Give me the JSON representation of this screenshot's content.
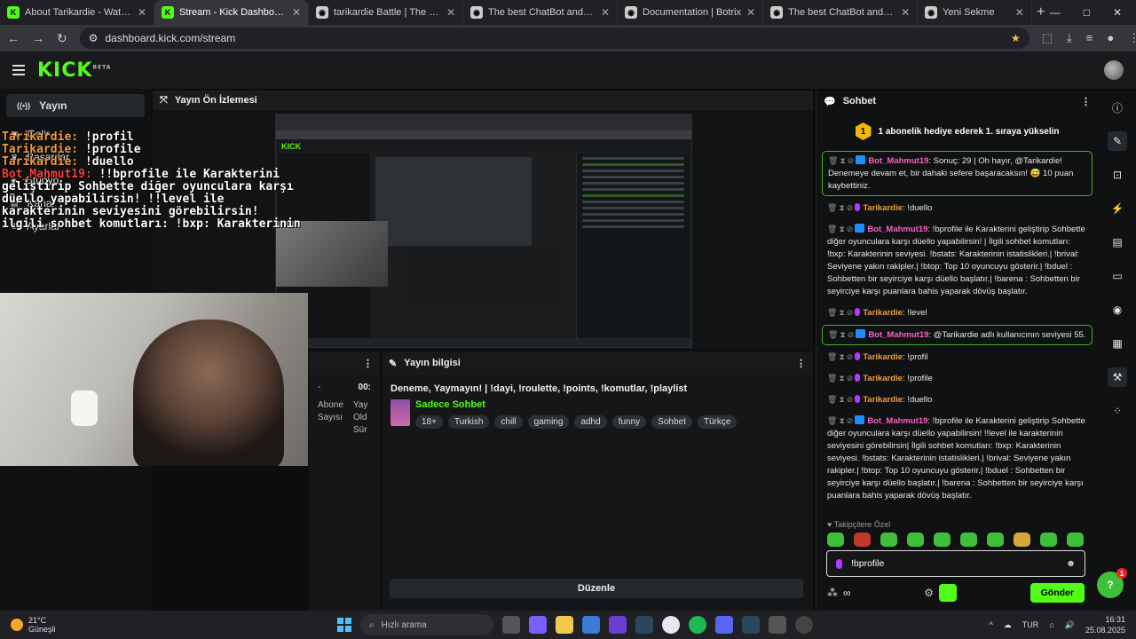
{
  "browser": {
    "tabs": [
      {
        "title": "About Tarikardie - Watch Live o",
        "color": "#53fc18",
        "fav": "K"
      },
      {
        "title": "Stream - Kick Dashboard",
        "color": "#53fc18",
        "fav": "K",
        "active": true
      },
      {
        "title": "tarikardie Battle | The best Chat",
        "color": "#cccccc",
        "fav": "◉"
      },
      {
        "title": "The best ChatBot and Widgets",
        "color": "#cccccc",
        "fav": "◉"
      },
      {
        "title": "Documentation | Botrix",
        "color": "#cccccc",
        "fav": "◉"
      },
      {
        "title": "The best ChatBot and Widgets",
        "color": "#cccccc",
        "fav": "◉"
      },
      {
        "title": "Yeni Sekme",
        "color": "#cccccc",
        "fav": "◉"
      }
    ],
    "url": "dashboard.kick.com/stream"
  },
  "app": {
    "logo": "KICK",
    "logo_tag": "BETA"
  },
  "leftnav": {
    "items": [
      {
        "label": "Yayın",
        "icon": "broadcast-icon"
      },
      {
        "label": "Gelir",
        "icon": "revenue-icon"
      },
      {
        "label": "Başarılar",
        "icon": "achievements-icon"
      },
      {
        "label": "Stüdyo",
        "icon": "studio-icon"
      },
      {
        "label": "Kanal",
        "icon": "channel-icon"
      },
      {
        "label": "Ayarlar",
        "icon": "settings-icon"
      }
    ]
  },
  "preview": {
    "title": "Yayın Ön İzlemesi",
    "mini_logo": "KICK"
  },
  "overlay_chat": [
    {
      "user": "Tarikardie:",
      "text": " !profil",
      "cls": "u1"
    },
    {
      "user": "Tarikardie:",
      "text": " !profile",
      "cls": "u1"
    },
    {
      "user": "Tarikardie:",
      "text": " !duello",
      "cls": "u1"
    },
    {
      "user": "Bot_Mahmut19:",
      "text": " !!bprofile ile Karakterini geliştirip Sohbette diğer oyunculara karşı düello yapabilirsin! !!level ile karakterinin seviyesini görebilirsin! ilgili sohbet komutları: !bxp: Karakterinin",
      "cls": "u2"
    }
  ],
  "stream_info": {
    "header": "Yayın bilgisi",
    "side_label_1": "-",
    "side_label_2": "Abone Sayısı",
    "side_time": "00:",
    "side_extra": "Yay Old Sür",
    "title": "Deneme, Yaymayın! | !dayi, !roulette, !points, !komutlar, !playlist",
    "category": "Sadece Sohbet",
    "tags": [
      "18+",
      "Turkish",
      "chill",
      "gaming",
      "adhd",
      "funny",
      "Sohbet",
      "Türkçe"
    ],
    "edit_button": "Düzenle"
  },
  "chat": {
    "header": "Sohbet",
    "goal_number": "1",
    "goal_text": "1 abonelik hediye ederek 1. sıraya yükselin",
    "messages": [
      {
        "user": "Bot_Mahmut19",
        "kind": "bot",
        "hl": true,
        "text": ": Sonuç: 29 | Oh hayır, @Tarikardie! Denemeye devam et, bir dahaki sefere başaracaksın! 😅 10 puan kaybettiniz."
      },
      {
        "user": "Tarikardie",
        "kind": "tar",
        "hl": false,
        "text": ": !duello"
      },
      {
        "user": "Bot_Mahmut19",
        "kind": "bot",
        "hl": false,
        "text": ": !bprofile ile Karakterini geliştirip Sohbette diğer oyunculara karşı düello yapabilirsin! | İlgili sohbet komutları: !bxp: Karakterinin seviyesi. !bstats: Karakterinin istatislikleri.| !brival: Seviyene yakın rakipler.| !btop: Top 10 oyuncuyu gösterir.| !bduel : Sohbetten bir seyirciye karşı düello başlatır.| !barena : Sohbetten bir seyirciye karşı puanlara bahis yaparak dövüş başlatır."
      },
      {
        "user": "Tarikardie",
        "kind": "tar",
        "hl": false,
        "text": ": !level"
      },
      {
        "user": "Bot_Mahmut19",
        "kind": "bot",
        "hl": true,
        "text": ": @Tarikardie adlı kullanıcının seviyesi 55."
      },
      {
        "user": "Tarikardie",
        "kind": "tar",
        "hl": false,
        "text": ": !profil"
      },
      {
        "user": "Tarikardie",
        "kind": "tar",
        "hl": false,
        "text": ": !profile"
      },
      {
        "user": "Tarikardie",
        "kind": "tar",
        "hl": false,
        "text": ": !duello"
      },
      {
        "user": "Bot_Mahmut19",
        "kind": "bot",
        "hl": false,
        "text": ": !bprofile ile Karakterini geliştirip Sohbette diğer oyunculara karşı düello yapabilirsin! !!level ile karakterinin seviyesini görebilirsin| İlgili sohbet komutları: !bxp: Karakterinin seviyesi. !bstats: Karakterinin istatislikleri.| !brival: Seviyene yakın rakipler.| !btop: Top 10 oyuncuyu gösterir.| !bduel : Sohbetten bir seyirciye karşı düello başlatır.| !barena : Sohbetten bir seyirciye karşı puanlara bahis yaparak dövüş başlatır."
      }
    ],
    "followers_label": "Takipçilere Özel",
    "input_value": "!bprofile",
    "send_label": "Gönder"
  },
  "help_badge": "1",
  "taskbar": {
    "temp": "21°C",
    "weather": "Güneşli",
    "search_placeholder": "Hızlı arama",
    "lang": "TUR",
    "time": "16:31",
    "date": "25.08.2025"
  }
}
